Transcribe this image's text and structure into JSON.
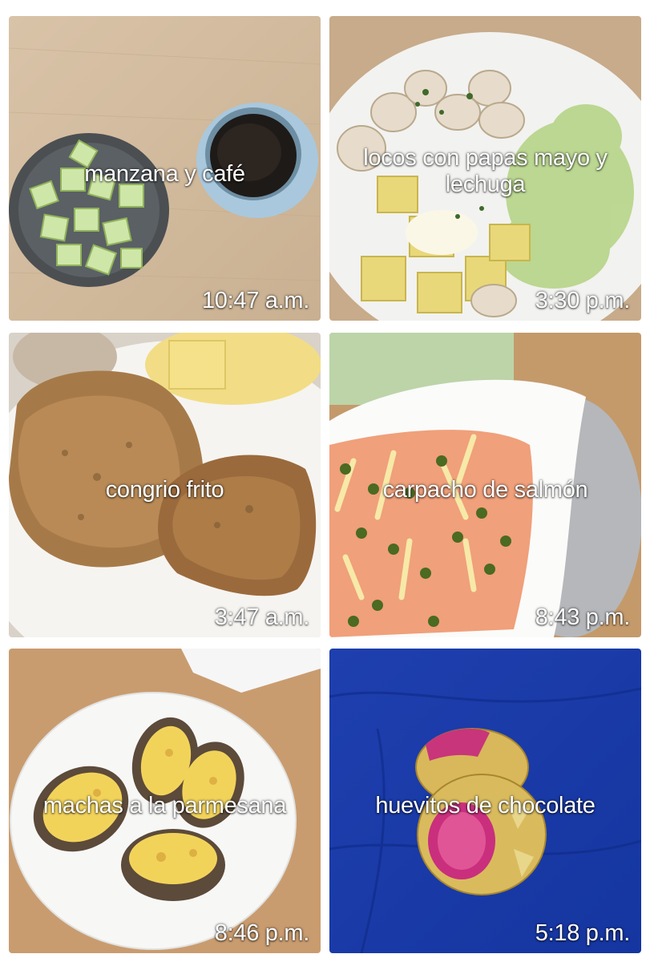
{
  "tiles": [
    {
      "caption": "manzana y café",
      "time": "10:47 a.m."
    },
    {
      "caption": "locos con papas mayo y lechuga",
      "time": "3:30 p.m."
    },
    {
      "caption": "congrio frito",
      "time": "3:47 a.m."
    },
    {
      "caption": "carpacho de salmón",
      "time": "8:43 p.m."
    },
    {
      "caption": "machas a la parmesana",
      "time": "8:46 p.m."
    },
    {
      "caption": "huevitos de chocolate",
      "time": "5:18 p.m."
    }
  ]
}
